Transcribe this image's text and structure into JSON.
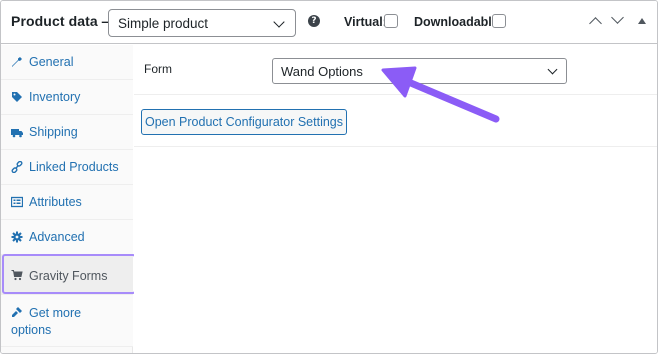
{
  "header": {
    "title": "Product data —",
    "product_type": "Simple product",
    "help_glyph": "?",
    "virtual_label": "Virtual:",
    "virtual_checked": false,
    "downloadable_label": "Downloadable:",
    "downloadable_checked": false
  },
  "tabs": [
    {
      "label": "General",
      "icon": "wrench-icon",
      "glyph": "🔧",
      "active": false
    },
    {
      "label": "Inventory",
      "icon": "tag-icon",
      "glyph": "◆",
      "active": false
    },
    {
      "label": "Shipping",
      "icon": "truck-icon",
      "glyph": "■",
      "active": false
    },
    {
      "label": "Linked Products",
      "icon": "link-icon",
      "glyph": "⌁",
      "active": false
    },
    {
      "label": "Attributes",
      "icon": "list-icon",
      "glyph": "▤",
      "active": false
    },
    {
      "label": "Advanced",
      "icon": "gear-icon",
      "glyph": "⚙",
      "active": false
    },
    {
      "label": "Gravity Forms",
      "icon": "cart-icon",
      "glyph": "⬛",
      "active": true
    },
    {
      "label": "Get more options",
      "icon": "plugin-icon",
      "glyph": "✎",
      "active": false
    }
  ],
  "main": {
    "form_label": "Form",
    "form_value": "Wand Options",
    "config_button": "Open Product Configurator Settings"
  },
  "colors": {
    "link": "#2271b1",
    "highlight": "#a78bfa",
    "arrow": "#8b5cf6"
  }
}
